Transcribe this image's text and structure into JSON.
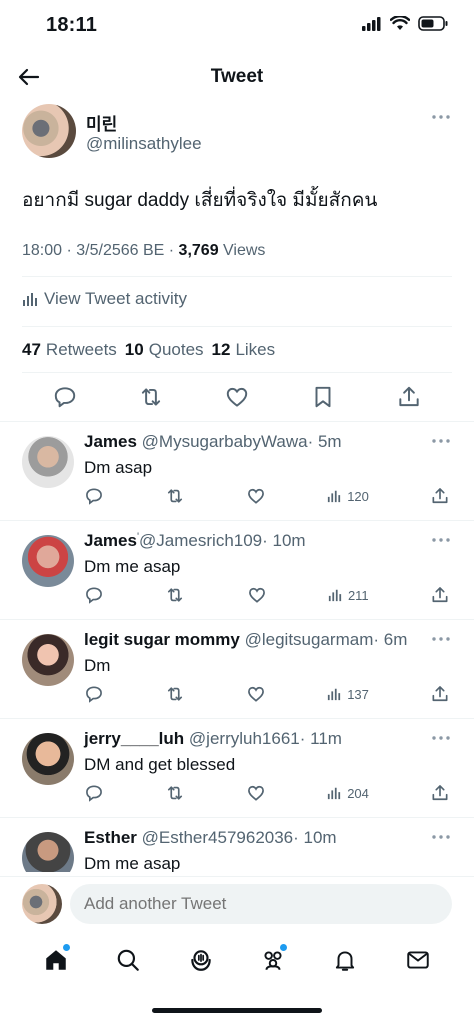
{
  "status_bar": {
    "time": "18:11"
  },
  "header": {
    "title": "Tweet"
  },
  "tweet": {
    "author_name": "미린",
    "author_handle": "@milinsathylee",
    "text": "อยากมี sugar daddy เสี่ยที่จริงใจ มีมั้ยสักคน",
    "timestamp": "18:00 · 3/5/2566 BE · ",
    "views_count": "3,769",
    "views_label": " Views",
    "activity_label": "View Tweet activity",
    "retweets_count": "47",
    "retweets_label": "Retweets",
    "quotes_count": "10",
    "quotes_label": "Quotes",
    "likes_count": "12",
    "likes_label": "Likes"
  },
  "replies": [
    {
      "name": "James",
      "handle": "@MysugarbabyWawa",
      "time": "· 5m",
      "text": "Dm asap",
      "views": "120"
    },
    {
      "name": "James",
      "verified_mark": "'",
      "handle": "@Jamesrich109",
      "time": "· 10m",
      "text": "Dm me asap",
      "views": "211"
    },
    {
      "name": "legit sugar mommy",
      "handle": "@legitsugarmam",
      "time": "· 6m",
      "text": "Dm",
      "views": "137"
    },
    {
      "name": "jerry____luh",
      "handle": "@jerryluh1661",
      "time": "· 11m",
      "text": "DM and get blessed",
      "views": "204"
    },
    {
      "name": "Esther",
      "handle": "@Esther457962036",
      "time": "· 10m",
      "text": "Dm me asap"
    }
  ],
  "compose": {
    "placeholder": "Add another Tweet"
  },
  "colors": {
    "accent": "#1d9bf0",
    "text": "#0f1419",
    "secondary": "#536471",
    "divider": "#eff3f4"
  },
  "icons": [
    "back-arrow-icon",
    "more-icon",
    "reply-icon",
    "retweet-icon",
    "like-icon",
    "bookmark-icon",
    "share-icon",
    "views-icon",
    "home-icon",
    "search-icon",
    "spaces-icon",
    "communities-icon",
    "notifications-icon",
    "messages-icon"
  ]
}
